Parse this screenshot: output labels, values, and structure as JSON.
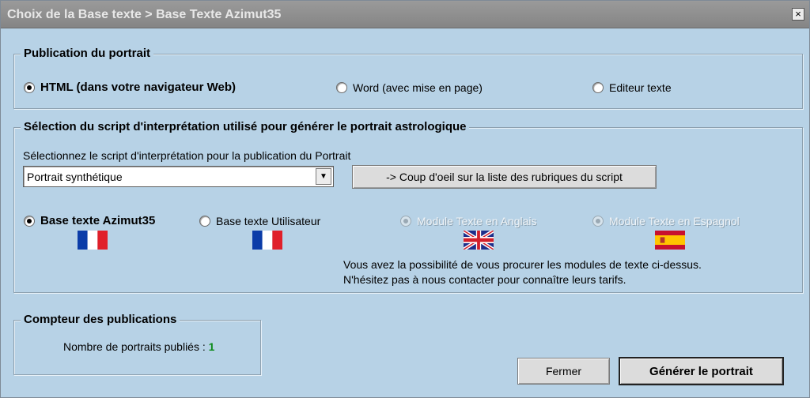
{
  "window": {
    "title": "Choix de la Base texte > Base Texte Azimut35",
    "close_label": "×"
  },
  "publication": {
    "legend": "Publication du portrait",
    "options": [
      {
        "label": "HTML (dans votre navigateur Web)",
        "checked": true
      },
      {
        "label": "Word (avec mise en page)",
        "checked": false
      },
      {
        "label": "Editeur texte",
        "checked": false
      }
    ]
  },
  "script_section": {
    "legend": "Sélection du script d'interprétation utilisé pour générer le portrait astrologique",
    "select_prompt": "Sélectionnez le script d'interprétation pour la publication du Portrait",
    "select_value": "Portrait synthétique",
    "preview_button": "-> Coup d'oeil sur la liste des rubriques du script",
    "bases": [
      {
        "label": "Base texte Azimut35",
        "checked": true,
        "enabled": true,
        "flag": "france-flag-icon"
      },
      {
        "label": "Base texte Utilisateur",
        "checked": false,
        "enabled": true,
        "flag": "france-flag-icon"
      },
      {
        "label": "Module Texte en Anglais",
        "checked": false,
        "enabled": false,
        "flag": "uk-flag-icon"
      },
      {
        "label": "Module Texte en Espagnol",
        "checked": false,
        "enabled": false,
        "flag": "spain-flag-icon"
      }
    ],
    "info_line1": "Vous avez la possibilité de vous procurer les modules de texte ci-dessus.",
    "info_line2": "N'hésitez pas à nous contacter pour connaître leurs tarifs."
  },
  "counter": {
    "legend": "Compteur des publications",
    "label": "Nombre de portraits publiés : ",
    "value": "1"
  },
  "buttons": {
    "close": "Fermer",
    "generate": "Générer le portrait"
  }
}
